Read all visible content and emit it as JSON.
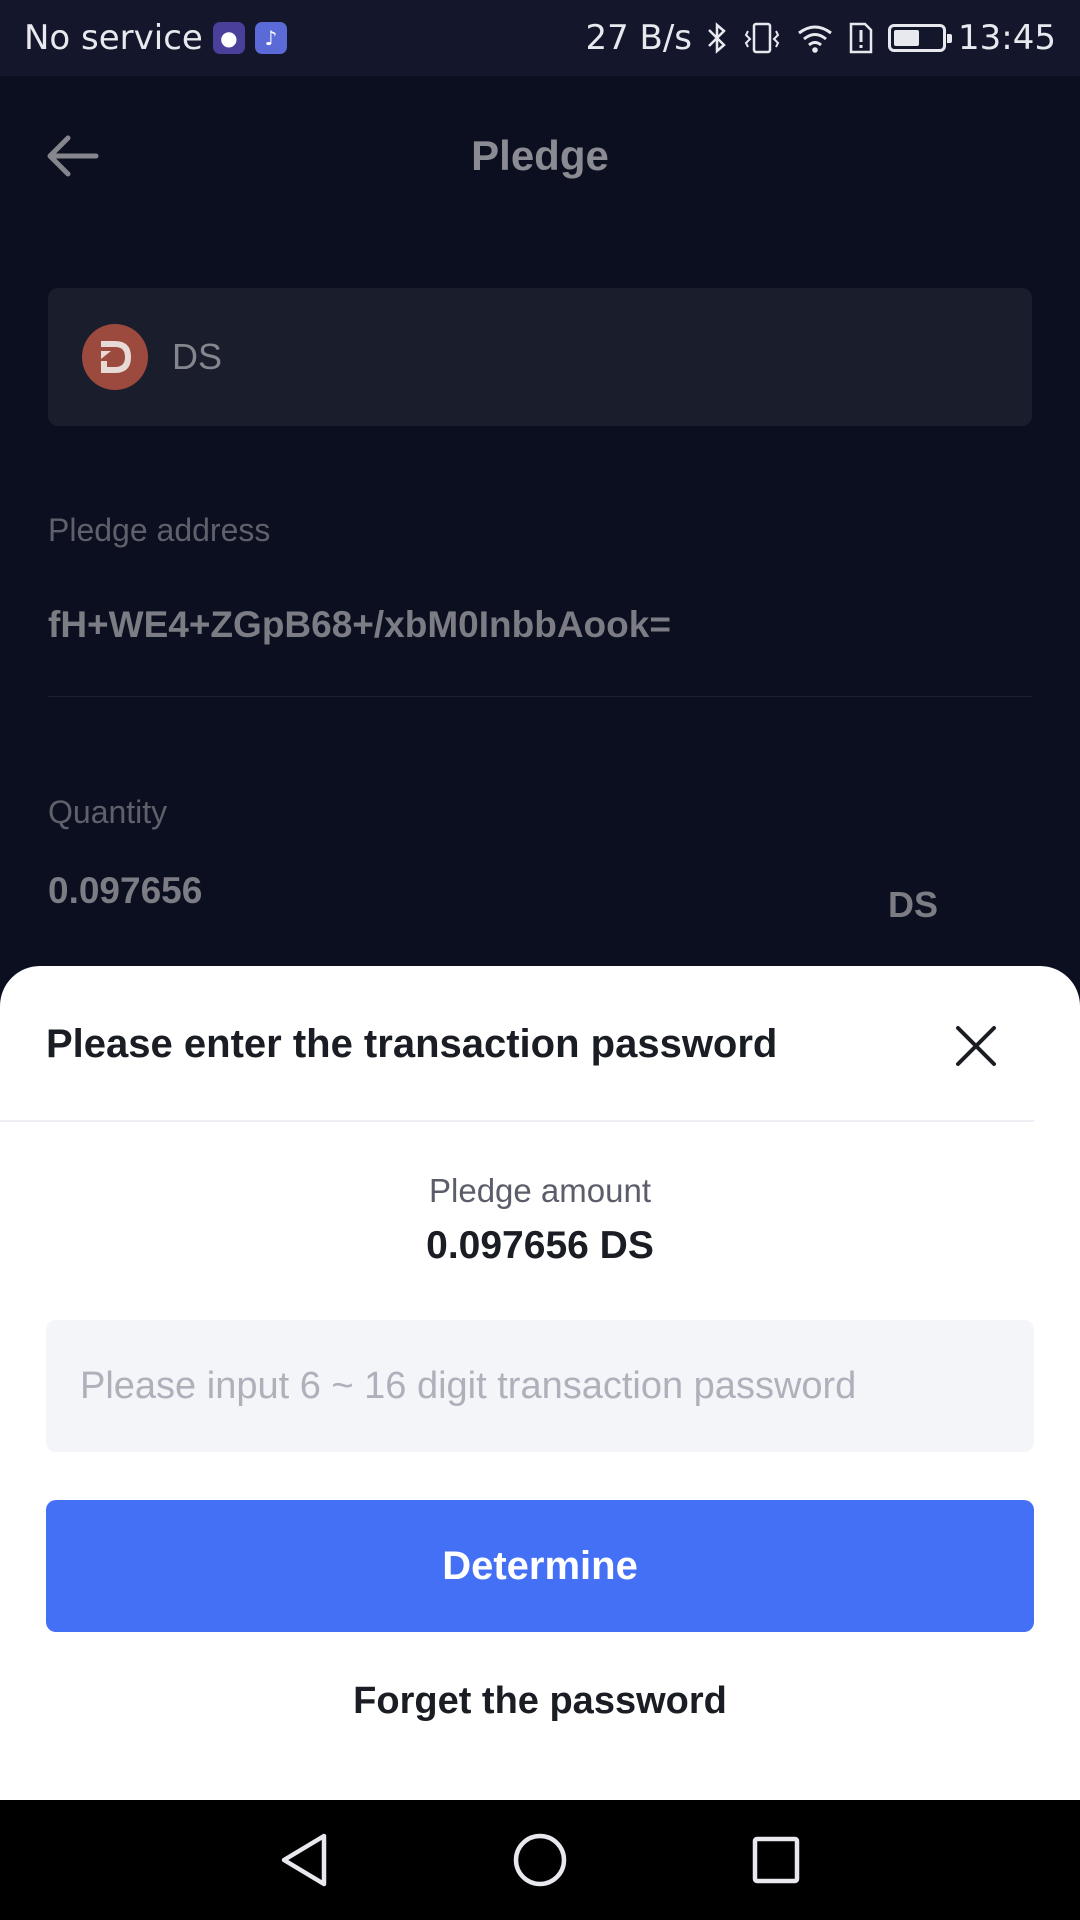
{
  "status_bar": {
    "carrier": "No service",
    "net_speed": "27 B/s",
    "time": "13:45",
    "battery_level_percent": 55,
    "icons": [
      "app-notification-icon",
      "music-icon",
      "bluetooth-icon",
      "vibrate-icon",
      "wifi-icon",
      "sim-alert-icon",
      "battery-icon"
    ]
  },
  "header": {
    "title": "Pledge",
    "back_icon": "arrow-left-icon"
  },
  "token": {
    "symbol": "DS",
    "logo_letter": "D",
    "logo_color": "#9c4a3e"
  },
  "address": {
    "label": "Pledge address",
    "value": "fH+WE4+ZGpB68+/xbM0InbbAook="
  },
  "quantity": {
    "label": "Quantity",
    "value": "0.097656",
    "unit": "DS"
  },
  "sheet": {
    "title": "Please enter the transaction password",
    "close_icon": "close-icon",
    "amount_label": "Pledge amount",
    "amount_value": "0.097656 DS",
    "password_placeholder": "Please input 6 ~ 16 digit transaction password",
    "password_value": "",
    "determine_label": "Determine",
    "forget_label": "Forget the password",
    "accent_color": "#4470f6"
  },
  "nav_bar": {
    "icons": [
      "back-triangle-icon",
      "home-circle-icon",
      "recents-square-icon"
    ]
  }
}
